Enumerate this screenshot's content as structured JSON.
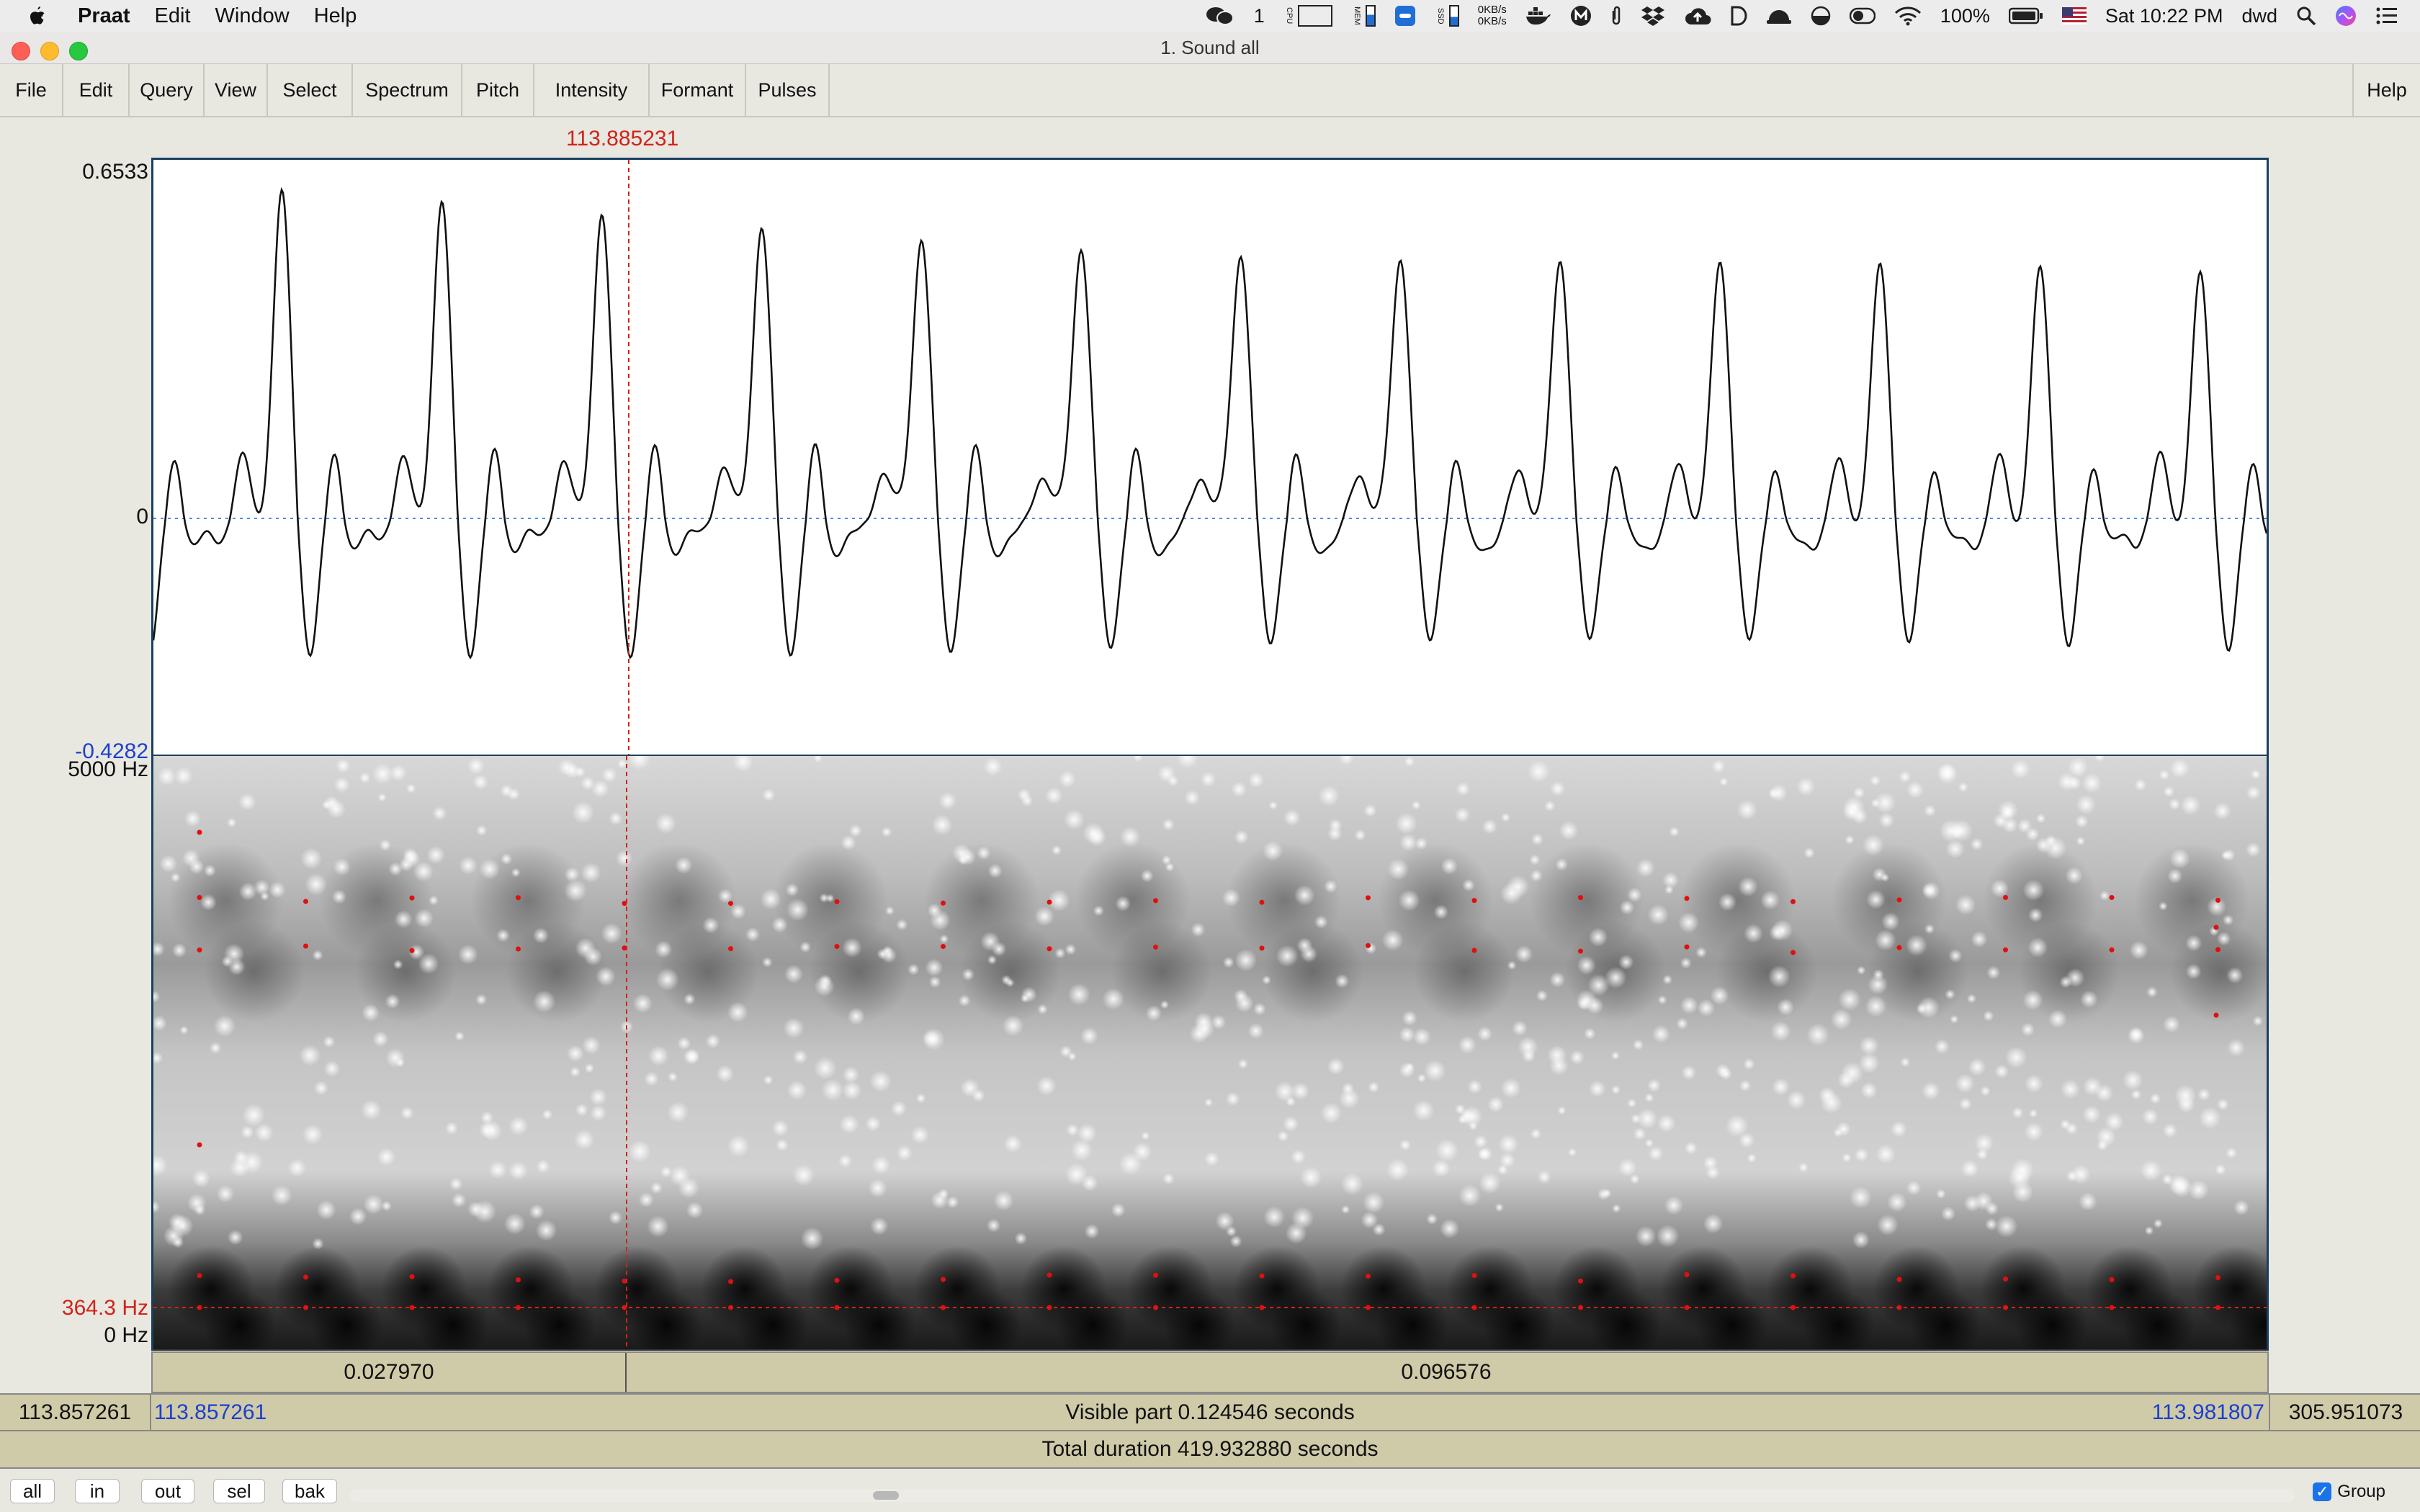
{
  "menubar": {
    "app_name": "Praat",
    "menus": [
      "Edit",
      "Window",
      "Help"
    ],
    "status": {
      "wechat_count": "1",
      "cpu_label": "CPU",
      "mem_label": "MEM",
      "ssd_label": "SSD",
      "net_up": "0KB/s",
      "net_down": "0KB/s",
      "battery": "100%",
      "clock": "Sat 10:22 PM",
      "user": "dwd"
    }
  },
  "window": {
    "title": "1. Sound all"
  },
  "toolbar": {
    "items": [
      "File",
      "Edit",
      "Query",
      "View",
      "Select",
      "Spectrum",
      "Pitch",
      "Intensity",
      "Formant",
      "Pulses"
    ],
    "help": "Help"
  },
  "waveform": {
    "cursor_time": "113.885231",
    "y_max": "0.6533",
    "y_zero": "0",
    "y_min": "-0.4282",
    "colors": {
      "wave": "#111111",
      "cursor": "#d0241a",
      "zero_line": "#4a8fe0"
    }
  },
  "spectrogram": {
    "freq_max": "5000 Hz",
    "freq_cursor": "364.3 Hz",
    "freq_min": "0 Hz",
    "colors": {
      "formant_dots": "#e01010"
    }
  },
  "time_bar": {
    "left_segment": "0.027970",
    "right_segment": "0.096576"
  },
  "visible_row": {
    "window_start": "113.857261",
    "visible_start": "113.857261",
    "visible_text": "Visible part 0.124546 seconds",
    "visible_end": "113.981807",
    "window_end": "305.951073"
  },
  "total_row": {
    "text": "Total duration 419.932880 seconds"
  },
  "bottom": {
    "buttons": [
      "all",
      "in",
      "out",
      "sel",
      "bak"
    ],
    "group_label": "Group"
  }
}
